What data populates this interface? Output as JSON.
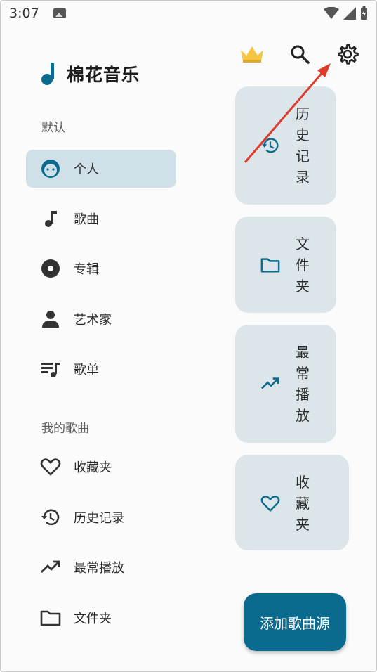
{
  "status_bar": {
    "time": "3:07"
  },
  "app": {
    "title": "棉花音乐"
  },
  "colors": {
    "accent": "#0b6b8e",
    "active_bg": "#cfe0e8",
    "card_bg": "#dce6ea",
    "annotation": "#e03a2a"
  },
  "sidebar": {
    "section_default": "默认",
    "items": [
      {
        "label": "个人",
        "icon": "face-icon"
      },
      {
        "label": "歌曲",
        "icon": "music-note-icon"
      },
      {
        "label": "专辑",
        "icon": "album-icon"
      },
      {
        "label": "艺术家",
        "icon": "person-icon"
      },
      {
        "label": "歌单",
        "icon": "playlist-icon"
      }
    ],
    "section_mine": "我的歌曲",
    "my_items": [
      {
        "label": "收藏夹",
        "icon": "heart-icon"
      },
      {
        "label": "历史记录",
        "icon": "history-icon"
      },
      {
        "label": "最常播放",
        "icon": "trending-icon"
      },
      {
        "label": "文件夹",
        "icon": "folder-icon"
      }
    ]
  },
  "cards": [
    {
      "chars": [
        "历",
        "史",
        "记",
        "录"
      ],
      "icon": "history-icon"
    },
    {
      "chars": [
        "文",
        "件",
        "夹"
      ],
      "icon": "folder-icon"
    },
    {
      "chars": [
        "最",
        "常",
        "播",
        "放"
      ],
      "icon": "trending-icon"
    },
    {
      "chars": [
        "收",
        "藏",
        "夹"
      ],
      "icon": "heart-icon"
    }
  ],
  "fab": {
    "label": "添加歌曲源"
  }
}
